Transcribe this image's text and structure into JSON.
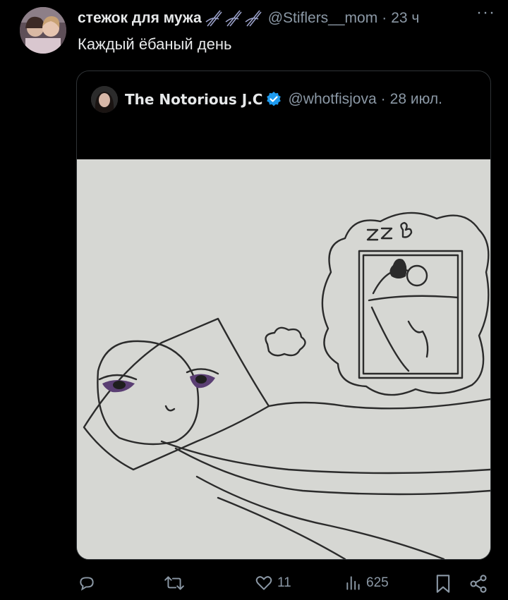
{
  "post": {
    "author_name": "стежок для мужа",
    "emoji_icon": "threads-needle-icon",
    "handle": "@Stiflers__mom",
    "separator": "·",
    "time": "23 ч",
    "more_icon": "more-horizontal-icon",
    "more_label": "···",
    "text": "Каждый ёбаный день"
  },
  "quote": {
    "author_name": "The Notorious J.C",
    "verified_icon": "verified-badge-icon",
    "handle": "@whotfisjova",
    "separator": "·",
    "date": "28 июл.",
    "media_description_icon": "drawing-image"
  },
  "actions": {
    "reply_icon": "reply-icon",
    "repost_icon": "repost-icon",
    "like_icon": "heart-icon",
    "like_count": "11",
    "views_icon": "views-icon",
    "views_count": "625",
    "bookmark_icon": "bookmark-icon",
    "share_icon": "share-icon"
  },
  "colors": {
    "background": "#000000",
    "text": "#e7e9ea",
    "muted": "#8b98a5",
    "verified": "#1d9bf0",
    "border": "#2f3336"
  }
}
